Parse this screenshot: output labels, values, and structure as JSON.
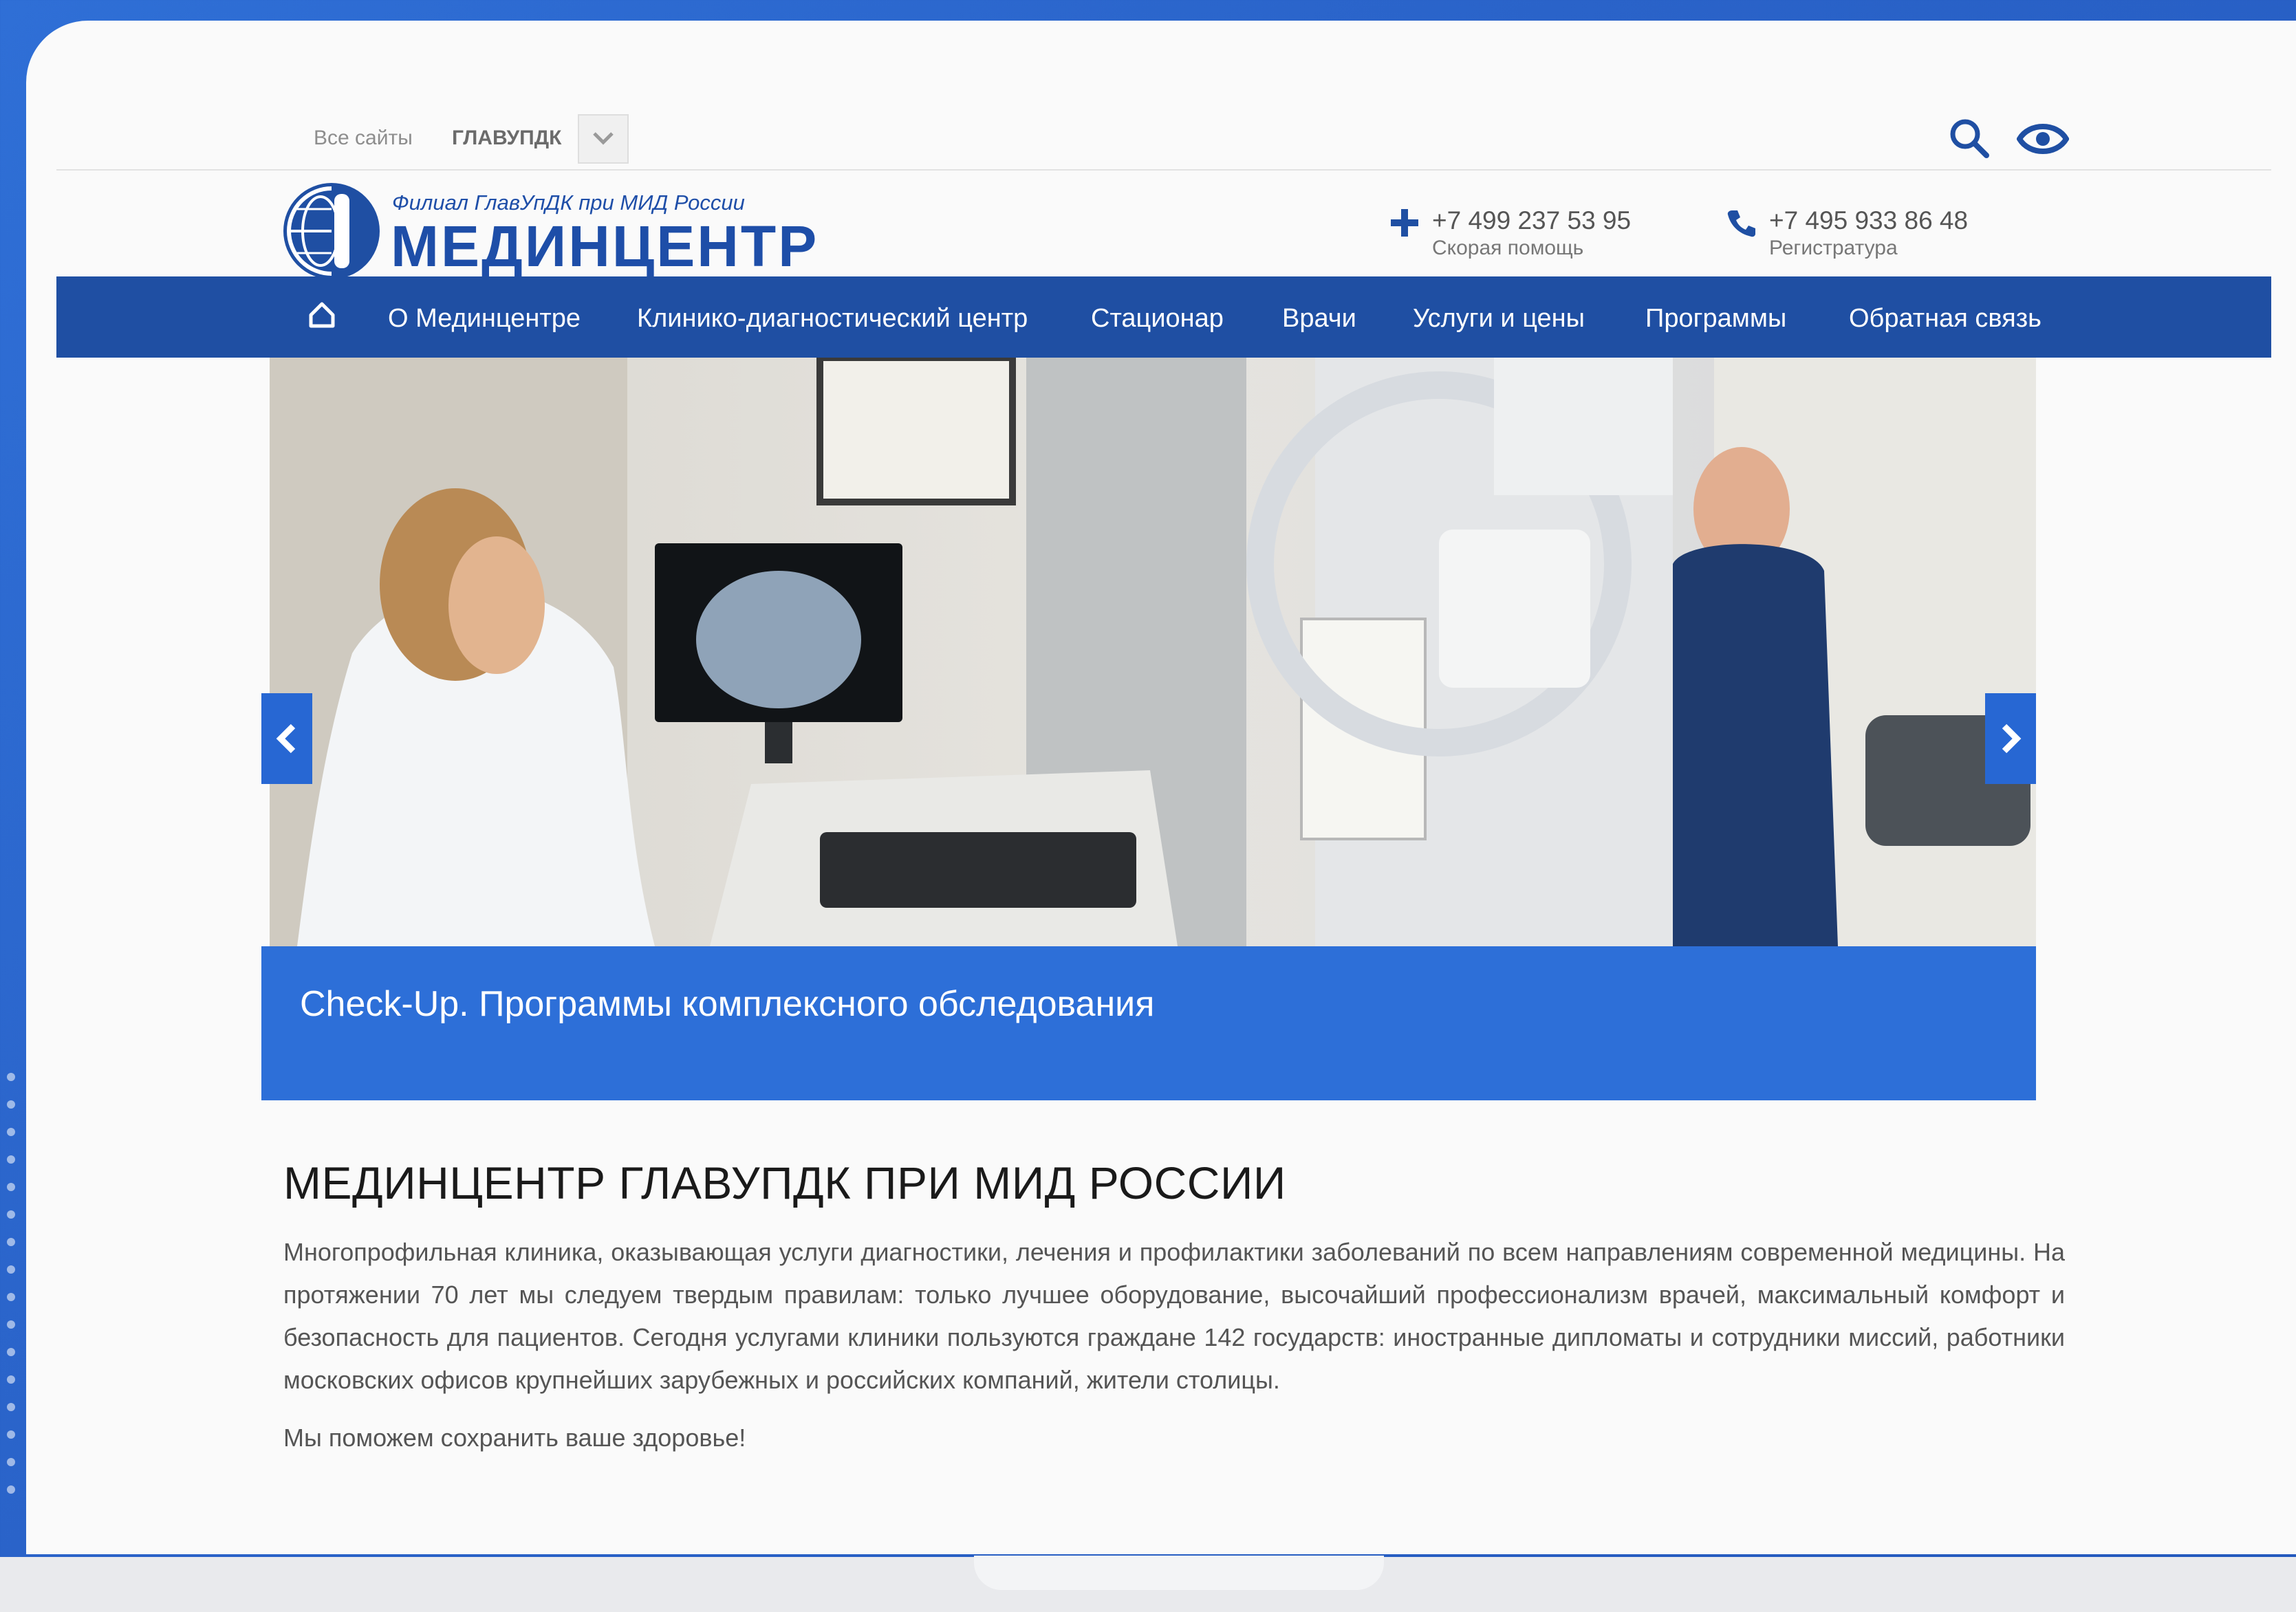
{
  "colors": {
    "brand_blue": "#1f4fa3",
    "accent_blue": "#2d6fd8",
    "background_blue": "#2a63c9",
    "text_gray": "#555555"
  },
  "topbar": {
    "sites_label": "Все сайты",
    "current_site": "ГЛАВУПДК",
    "icons": [
      "chevron-down-icon",
      "search-icon",
      "eye-icon"
    ]
  },
  "logo": {
    "subtitle": "Филиал ГлавУпДК при МИД России",
    "title": "МЕДИНЦЕНТР",
    "icon": "globe-logo-icon"
  },
  "contacts": {
    "emergency_phone": "+7 499 237 53 95",
    "emergency_label": "Скорая помощь",
    "registry_phone": "+7 495 933 86 48",
    "registry_label": "Регистратура"
  },
  "nav": {
    "home_icon": "home-icon",
    "items": [
      {
        "label": "О Мединцентре"
      },
      {
        "label": "Клинико-диагностический центр"
      },
      {
        "label": "Стационар"
      },
      {
        "label": "Врачи"
      },
      {
        "label": "Услуги и цены"
      },
      {
        "label": "Программы"
      },
      {
        "label": "Обратная связь"
      }
    ]
  },
  "slider": {
    "caption": "Check-Up. Программы комплексного обследования",
    "prev_icon": "chevron-left-icon",
    "next_icon": "chevron-right-icon"
  },
  "main": {
    "title": "МЕДИНЦЕНТР ГЛАВУПДК ПРИ МИД РОССИИ",
    "intro": "Многопрофильная клиника, оказывающая услуги диагностики, лечения и профилактики заболеваний по всем направлениям современной медицины. На протяжении 70 лет мы следуем твердым правилам:  только лучшее оборудование, высочайший профессионализм врачей, максимальный комфорт и безопасность для пациентов. Сегодня услугами клиники пользуются граждане 142 государств: иностранные дипломаты и сотрудники миссий, работники московских офисов крупнейших зарубежных и российских компаний, жители столицы.",
    "tagline": "Мы поможем сохранить ваше здоровье!"
  }
}
